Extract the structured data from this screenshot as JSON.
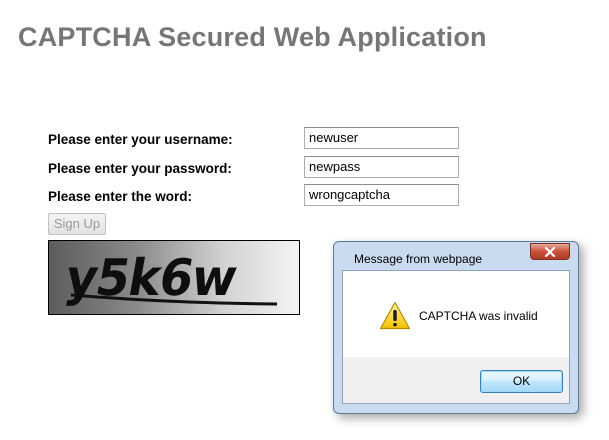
{
  "page": {
    "title": "CAPTCHA Secured Web Application"
  },
  "form": {
    "username_label": "Please enter your username:",
    "username_value": "newuser",
    "password_label": "Please enter your password:",
    "password_value": "newpass",
    "word_label": "Please enter the word:",
    "word_value": "wrongcaptcha",
    "signup_label": "Sign Up"
  },
  "captcha": {
    "text": "y5k6w"
  },
  "dialog": {
    "title": "Message from webpage",
    "message": "CAPTCHA was invalid",
    "ok_label": "OK",
    "icon": "warning-icon"
  }
}
